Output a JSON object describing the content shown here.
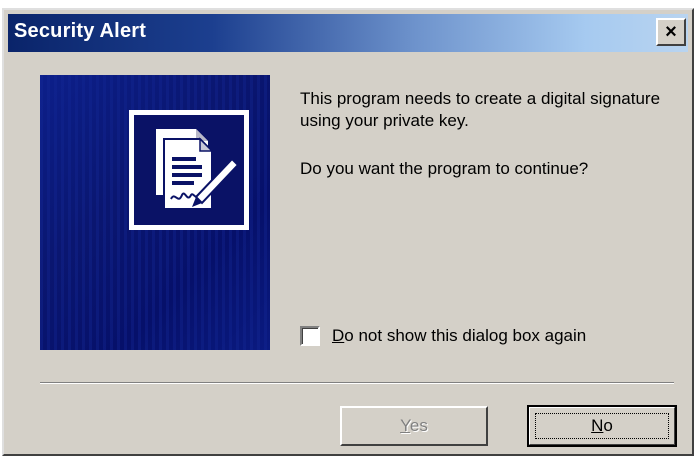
{
  "window": {
    "title": "Security Alert",
    "close_label": "×"
  },
  "message": {
    "line": "This program needs to create a digital signature using your private key.",
    "question": "Do you want the program to continue?"
  },
  "checkbox": {
    "label_mnemonic": "D",
    "label_rest": "o not show this dialog box again",
    "checked": false
  },
  "buttons": {
    "yes_mnemonic": "Y",
    "yes_rest": "es",
    "yes_enabled": false,
    "no_mnemonic": "N",
    "no_rest": "o"
  },
  "icons": {
    "banner": "signed-document-pen-icon",
    "close": "close-icon"
  },
  "colors": {
    "title_start": "#0a246a",
    "title_end": "#b9d4f0",
    "dialog_face": "#d4d0c8",
    "banner_blue": "#0a1670"
  }
}
